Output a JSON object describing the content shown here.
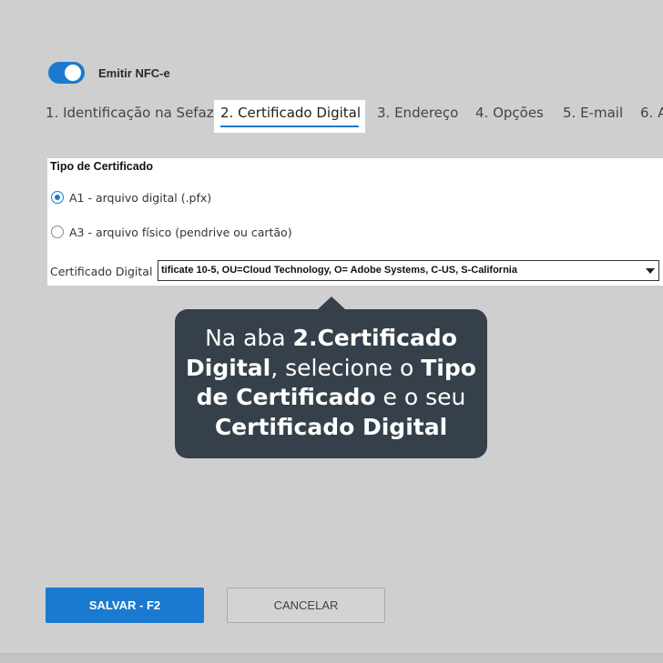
{
  "toggle": {
    "label": "Emitir NFC-e",
    "on": true
  },
  "tabs": [
    {
      "label": "1. Identificação na Sefaz"
    },
    {
      "label": "2. Certificado Digital",
      "active": true
    },
    {
      "label": "3. Endereço"
    },
    {
      "label": "4. Opções"
    },
    {
      "label": "5. E-mail"
    },
    {
      "label": "6. A"
    }
  ],
  "form": {
    "section_title": "Tipo de Certificado",
    "options": [
      {
        "label": "A1 - arquivo digital (.pfx)",
        "selected": true
      },
      {
        "label": "A3 - arquivo físico (pendrive ou cartão)",
        "selected": false
      }
    ],
    "certificate_label": "Certificado Digital",
    "certificate_value": "tificate 10-5, OU=Cloud Technology, O= Adobe Systems, C-US, S-California"
  },
  "tooltip": {
    "parts": [
      {
        "text": "Na aba ",
        "bold": false
      },
      {
        "text": "2.Certificado Digital",
        "bold": true
      },
      {
        "text": ", selecione o ",
        "bold": false
      },
      {
        "text": "Tipo de Certificado",
        "bold": true
      },
      {
        "text": " e o seu ",
        "bold": false
      },
      {
        "text": "Certificado Digital",
        "bold": true
      }
    ]
  },
  "buttons": {
    "save": "SALVAR - F2",
    "cancel": "CANCELAR"
  },
  "colors": {
    "accent": "#1a7ad0",
    "tooltip_bg": "#36404a",
    "page_bg": "#cfcfcf"
  }
}
